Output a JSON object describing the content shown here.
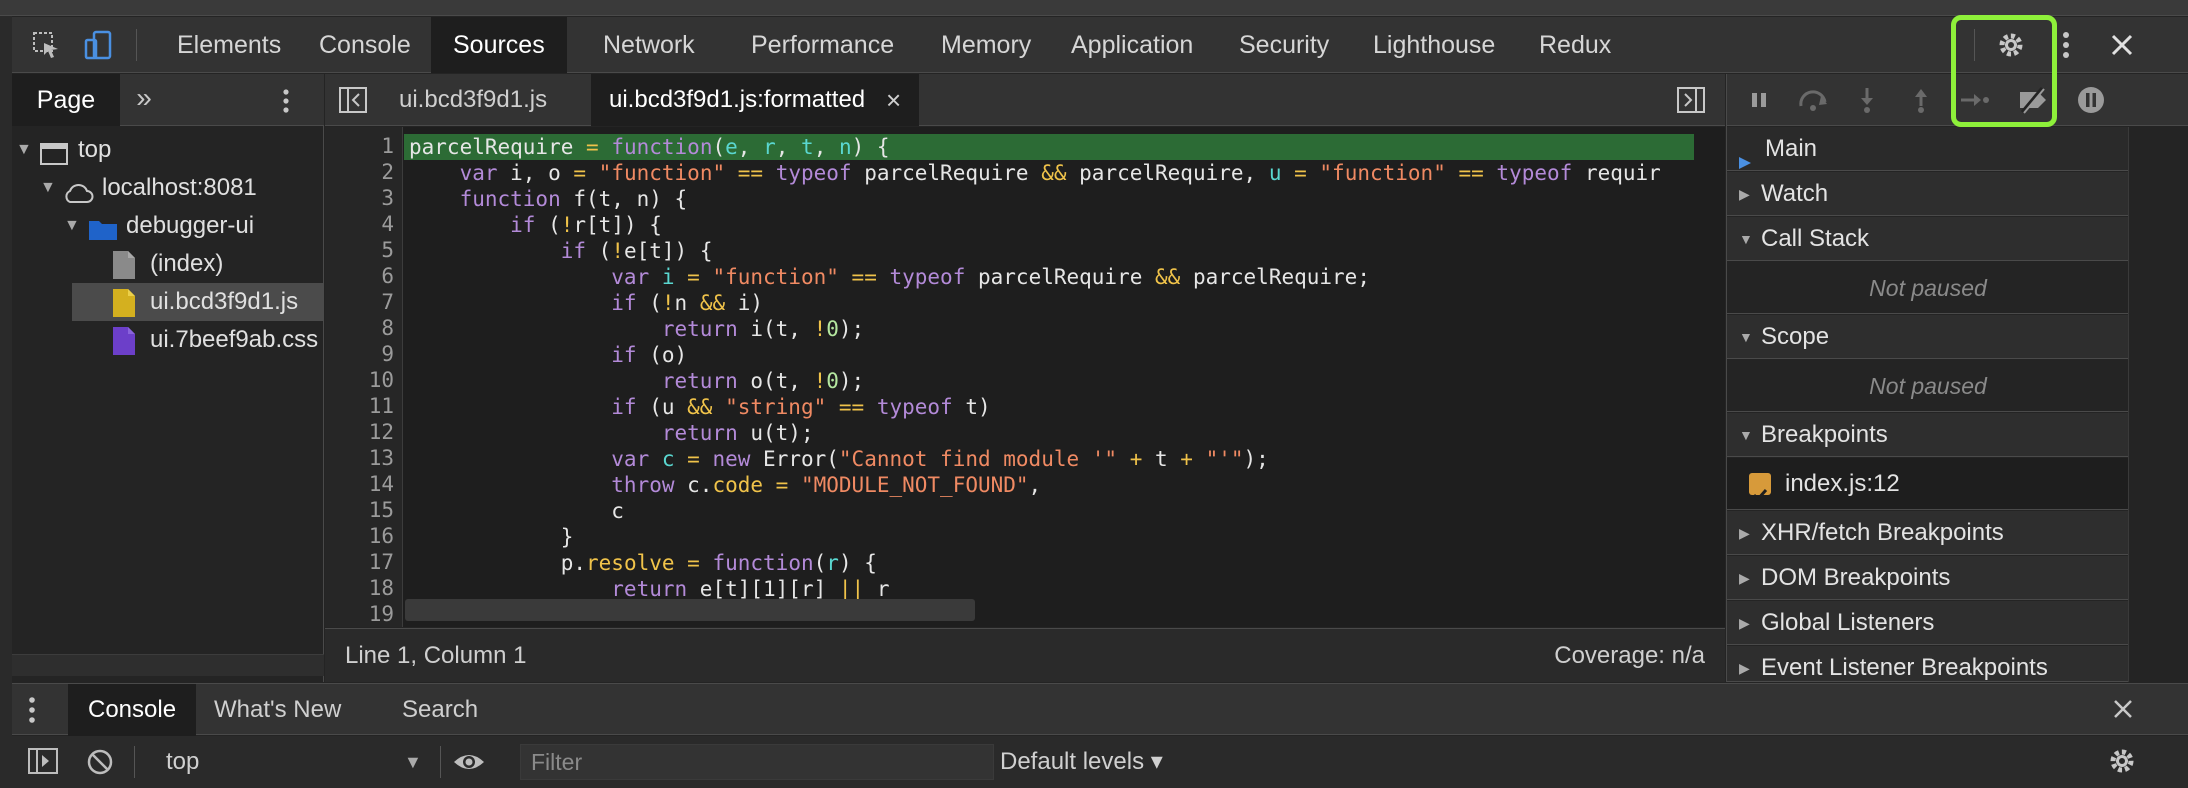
{
  "main_tabs": [
    "Elements",
    "Console",
    "Sources",
    "Network",
    "Performance",
    "Memory",
    "Application",
    "Security",
    "Lighthouse",
    "Redux"
  ],
  "navigator": {
    "tab": "Page",
    "more": "»",
    "tree": [
      {
        "label": "top"
      },
      {
        "label": "localhost:8081"
      },
      {
        "label": "debugger-ui"
      },
      {
        "label": "(index)"
      },
      {
        "label": "ui.bcd3f9d1.js"
      },
      {
        "label": "ui.7beef9ab.css"
      }
    ]
  },
  "editor": {
    "tabs": [
      {
        "label": "ui.bcd3f9d1.js"
      },
      {
        "label": "ui.bcd3f9d1.js:formatted",
        "close": "×"
      }
    ],
    "line_numbers": [
      "1",
      "2",
      "3",
      "4",
      "5",
      "6",
      "7",
      "8",
      "9",
      "10",
      "11",
      "12",
      "13",
      "14",
      "15",
      "16",
      "17",
      "18",
      "19"
    ],
    "status_position": "Line 1, Column 1",
    "status_coverage": "Coverage: n/a"
  },
  "debugger": {
    "main_thread": "Main",
    "sections": {
      "watch": "Watch",
      "call_stack": "Call Stack",
      "call_stack_empty": "Not paused",
      "scope": "Scope",
      "scope_empty": "Not paused",
      "breakpoints": "Breakpoints",
      "breakpoint_item": "index.js:12",
      "xhr": "XHR/fetch Breakpoints",
      "dom": "DOM Breakpoints",
      "global": "Global Listeners",
      "event": "Event Listener Breakpoints"
    }
  },
  "drawer": {
    "tabs": [
      "Console",
      "What's New",
      "Search"
    ],
    "context": "top",
    "filter_placeholder": "Filter",
    "levels": "Default levels ▾"
  },
  "colors": {
    "highlight": "#8ef03a",
    "current_line": "#2c6b35",
    "accent_blue": "#4a90e2"
  }
}
